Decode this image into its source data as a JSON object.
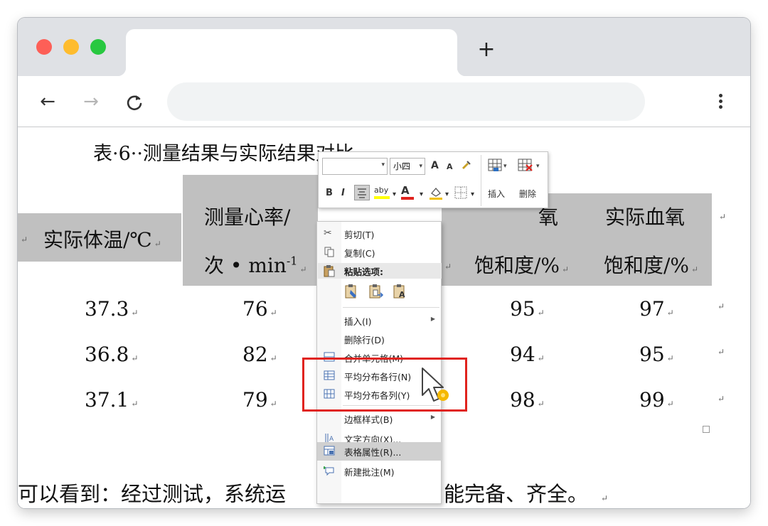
{
  "browser": {
    "new_tab_label": "+",
    "back_glyph": "←",
    "forward_glyph": "→",
    "reload_glyph": "C",
    "icons": [
      "close-dot",
      "minimize-dot",
      "maximize-dot",
      "back-arrow-icon",
      "forward-arrow-icon",
      "reload-icon",
      "more-menu-icon"
    ]
  },
  "document": {
    "caption": "表·6··测量结果与实际结果对比",
    "table": {
      "headers": {
        "actual_temp": "实际体温/℃",
        "measured_hr_line1": "测量心率/",
        "measured_hr_line2": "次 • min",
        "measured_hr_sup": "-1",
        "measured_spo2_part": "氧",
        "measured_spo2_line2": "饱和度/%",
        "actual_spo2_line1": "实际血氧",
        "actual_spo2_line2": "饱和度/%"
      },
      "rows": [
        {
          "temp": "37.3",
          "hr": "76",
          "spo2_measured": "95",
          "spo2_actual": "97"
        },
        {
          "temp": "36.8",
          "hr": "82",
          "spo2_measured": "94",
          "spo2_actual": "95"
        },
        {
          "temp": "37.1",
          "hr": "79",
          "spo2_measured": "98",
          "spo2_actual": "99"
        }
      ],
      "cell_mark": "↵"
    },
    "body_text_left": "可以看到：经过测试，系统运",
    "body_text_right": "能完备、齐全。"
  },
  "mini_toolbar": {
    "font_size": "小四",
    "grow_font": "A",
    "shrink_font": "A",
    "bold": "B",
    "italic": "I",
    "highlight": "aby",
    "font_color": "A",
    "insert_label": "插入",
    "delete_label": "删除"
  },
  "context_menu": {
    "cut": "剪切(T)",
    "copy": "复制(C)",
    "paste_options": "粘贴选项:",
    "insert": "插入(I)",
    "delete_row": "删除行(D)",
    "merge_cells": "合并单元格(M)",
    "distribute_rows": "平均分布各行(N)",
    "distribute_cols": "平均分布各列(Y)",
    "border_styles": "边框样式(B)",
    "text_direction": "文字方向(X)...",
    "table_properties": "表格属性(R)...",
    "new_comment": "新建批注(M)"
  },
  "colors": {
    "header_fill": "#c0c0c0",
    "highlight_box": "#e0231e",
    "cursor_accent": "#f5b800"
  }
}
